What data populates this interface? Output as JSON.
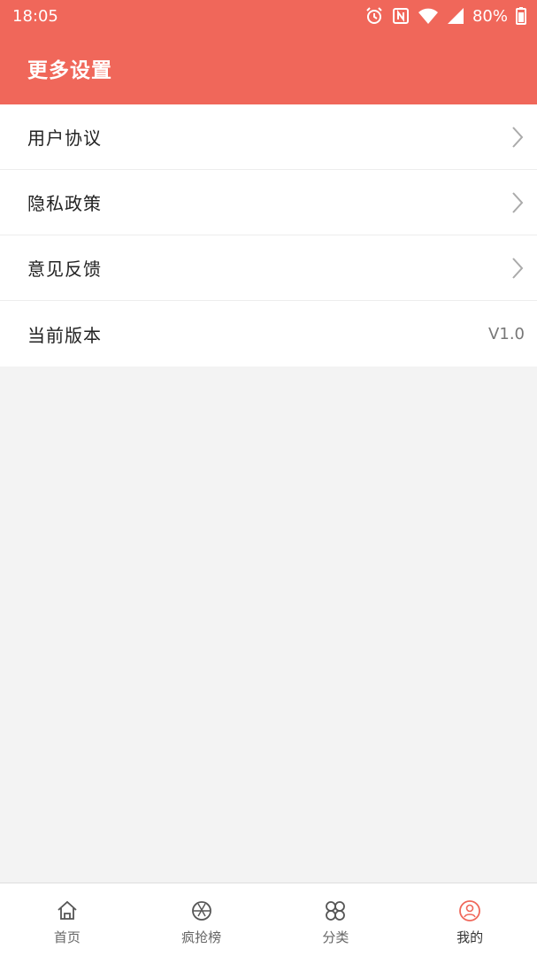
{
  "status_bar": {
    "time": "18:05",
    "battery": "80%",
    "icons": [
      "alarm-icon",
      "nfc-icon",
      "wifi-icon",
      "cell-signal-icon",
      "battery-icon"
    ]
  },
  "header": {
    "title": "更多设置",
    "color": "#f0675a"
  },
  "menu": {
    "items": [
      {
        "label": "用户协议",
        "icon": "chevron-right-icon"
      },
      {
        "label": "隐私政策",
        "icon": "chevron-right-icon"
      },
      {
        "label": "意见反馈",
        "icon": "chevron-right-icon"
      },
      {
        "label": "当前版本",
        "value": "V1.0"
      }
    ]
  },
  "bottom_nav": {
    "items": [
      {
        "label": "首页",
        "icon": "home-icon"
      },
      {
        "label": "疯抢榜",
        "icon": "aperture-icon"
      },
      {
        "label": "分类",
        "icon": "category-icon"
      },
      {
        "label": "我的",
        "icon": "profile-icon",
        "active": true
      }
    ],
    "active_color": "#f0675a"
  }
}
